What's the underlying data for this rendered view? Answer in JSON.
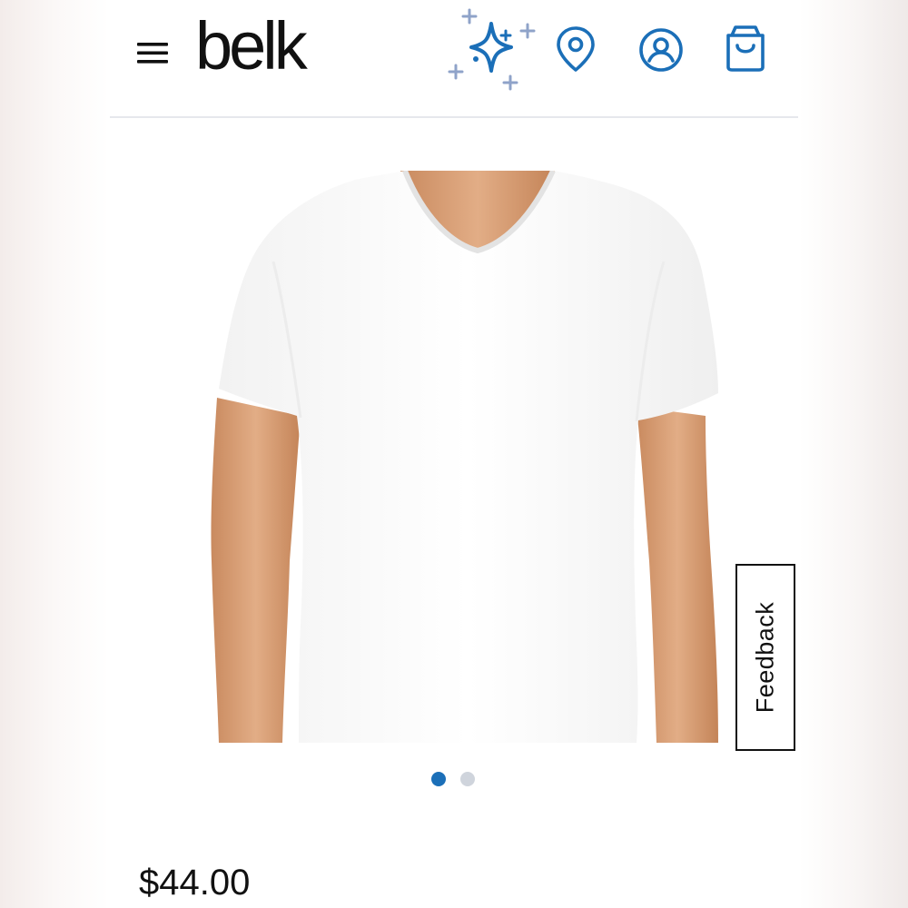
{
  "header": {
    "logo_text": "belk",
    "icons": [
      "menu-icon",
      "sparkle-ai-icon",
      "location-pin-icon",
      "account-icon",
      "shopping-bag-icon"
    ],
    "brand_blue": "#1b6fb8",
    "sparkle_secondary": "#8fa3c9"
  },
  "product": {
    "image": "white-v-neck-t-shirt",
    "carousel": {
      "count": 2,
      "active": 1
    },
    "price": "$44.00"
  },
  "feedback": {
    "label": "Feedback"
  }
}
